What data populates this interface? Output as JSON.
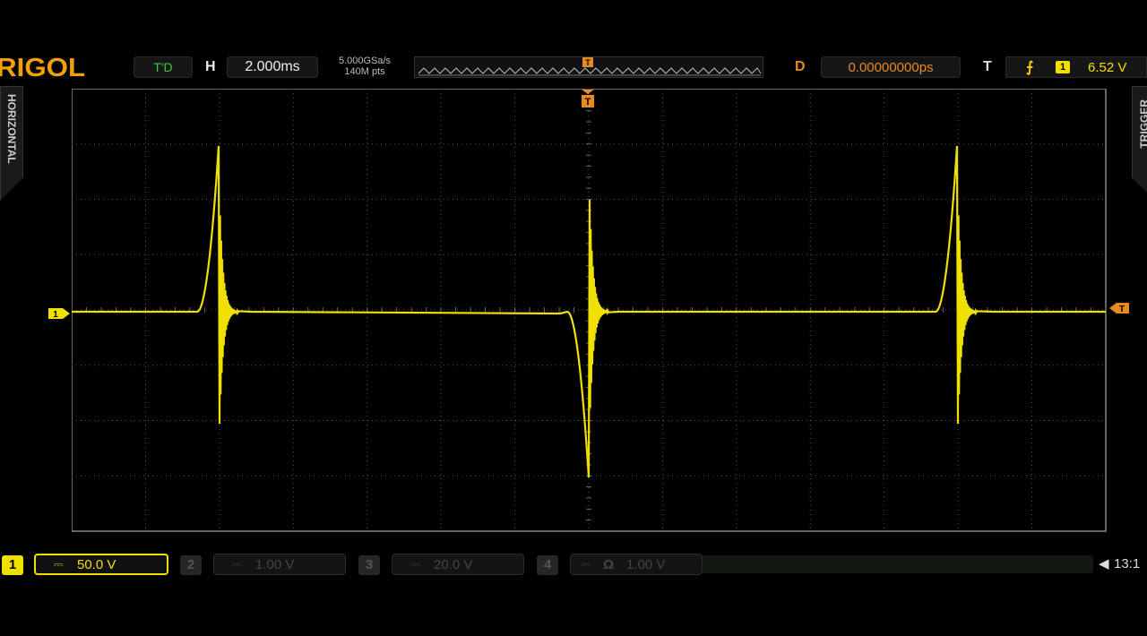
{
  "brand": "RIGOL",
  "top": {
    "run_status": "T'D",
    "h_label": "H",
    "timebase": "2.000ms",
    "sample_rate": "5.000GSa/s",
    "mem_depth": "140M pts",
    "d_label": "D",
    "delay": "0.00000000ps",
    "t_label": "T",
    "trigger_source": "1",
    "trigger_level": "6.52 V",
    "trigger_marker": "T"
  },
  "side": {
    "left_tab": "HORIZONTAL",
    "right_tab": "TRIGGER"
  },
  "channels": [
    {
      "num": "1",
      "coupling": "⎓",
      "scale": "50.0 V",
      "active": true,
      "ohm": ""
    },
    {
      "num": "2",
      "coupling": "⎓",
      "scale": "1.00 V",
      "active": false,
      "ohm": ""
    },
    {
      "num": "3",
      "coupling": "⎓",
      "scale": "20.0 V",
      "active": false,
      "ohm": ""
    },
    {
      "num": "4",
      "coupling": "⎓",
      "scale": "1.00 V",
      "active": false,
      "ohm": "Ω"
    }
  ],
  "clock": "13:1",
  "colors": {
    "ch1": "#f0e000",
    "brand": "#f0a000",
    "delay": "#e88a20",
    "grid": "#3a3a3a"
  },
  "icons": {
    "trigger_edge": "rising-edge-icon",
    "speaker": "speaker-icon"
  }
}
